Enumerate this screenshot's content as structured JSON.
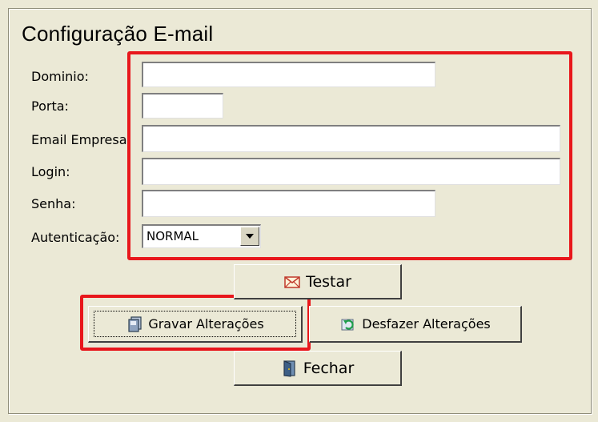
{
  "window": {
    "title": "Configuração E-mail"
  },
  "form": {
    "dominio": {
      "label": "Dominio:",
      "value": ""
    },
    "porta": {
      "label": "Porta:",
      "value": ""
    },
    "email_empresa": {
      "label": "Email Empresa",
      "value": ""
    },
    "login": {
      "label": "Login:",
      "value": ""
    },
    "senha": {
      "label": "Senha:",
      "value": ""
    },
    "autenticacao": {
      "label": "Autenticação:",
      "selected": "NORMAL"
    }
  },
  "buttons": {
    "testar": "Testar",
    "gravar": "Gravar Alterações",
    "desfazer": "Desfazer Alterações",
    "fechar": "Fechar"
  },
  "icons": {
    "testar": "envelope-icon",
    "gravar": "save-icon",
    "desfazer": "undo-icon",
    "fechar": "exit-door-icon"
  },
  "colors": {
    "highlight": "#e8171c",
    "background": "#ebe9d6"
  }
}
